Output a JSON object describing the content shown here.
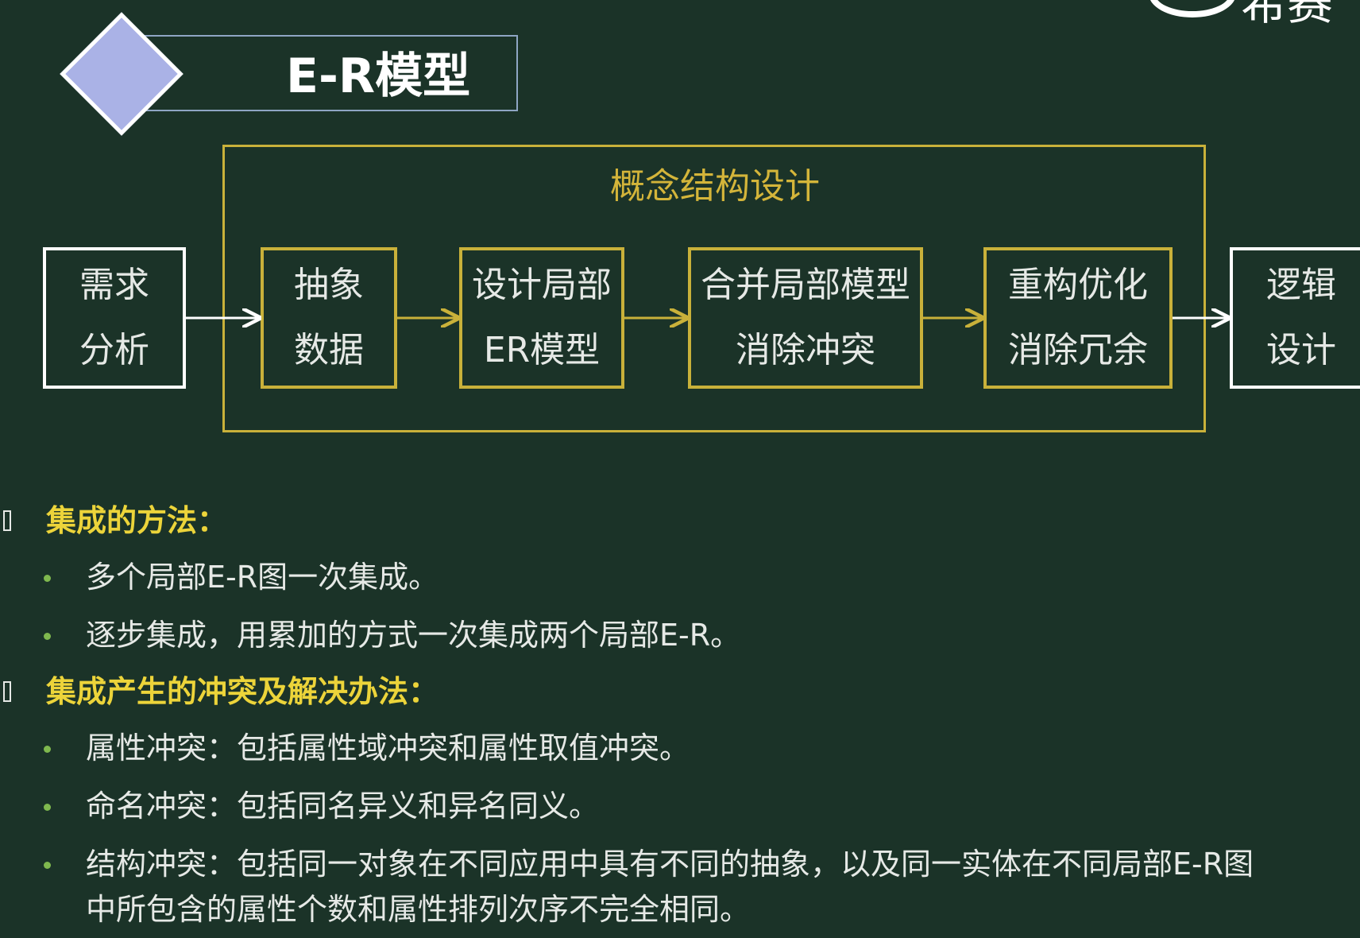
{
  "title": "E-R模型",
  "logo_text": "希赛",
  "diagram": {
    "group_label": "概念结构设计",
    "input": [
      "需求",
      "分析"
    ],
    "steps": [
      [
        "抽象",
        "数据"
      ],
      [
        "设计局部",
        "ER模型"
      ],
      [
        "合并局部模型",
        "消除冲突"
      ],
      [
        "重构优化",
        "消除冗余"
      ]
    ],
    "output": [
      "逻辑",
      "设计"
    ]
  },
  "sections": [
    {
      "heading": "集成的方法：",
      "items": [
        [
          "多个局部E-R图一次集成。"
        ],
        [
          "逐步集成，用累加的方式一次集成两个局部E-R。"
        ]
      ]
    },
    {
      "heading": "集成产生的冲突及解决办法：",
      "items": [
        [
          "属性冲突：包括属性域冲突和属性取值冲突。"
        ],
        [
          "命名冲突：包括同名异义和异名同义。"
        ],
        [
          "结构冲突：包括同一对象在不同应用中具有不同的抽象，以及同一实体在不同局部E-R图",
          "中所包含的属性个数和属性排列次序不完全相同。"
        ]
      ]
    }
  ]
}
